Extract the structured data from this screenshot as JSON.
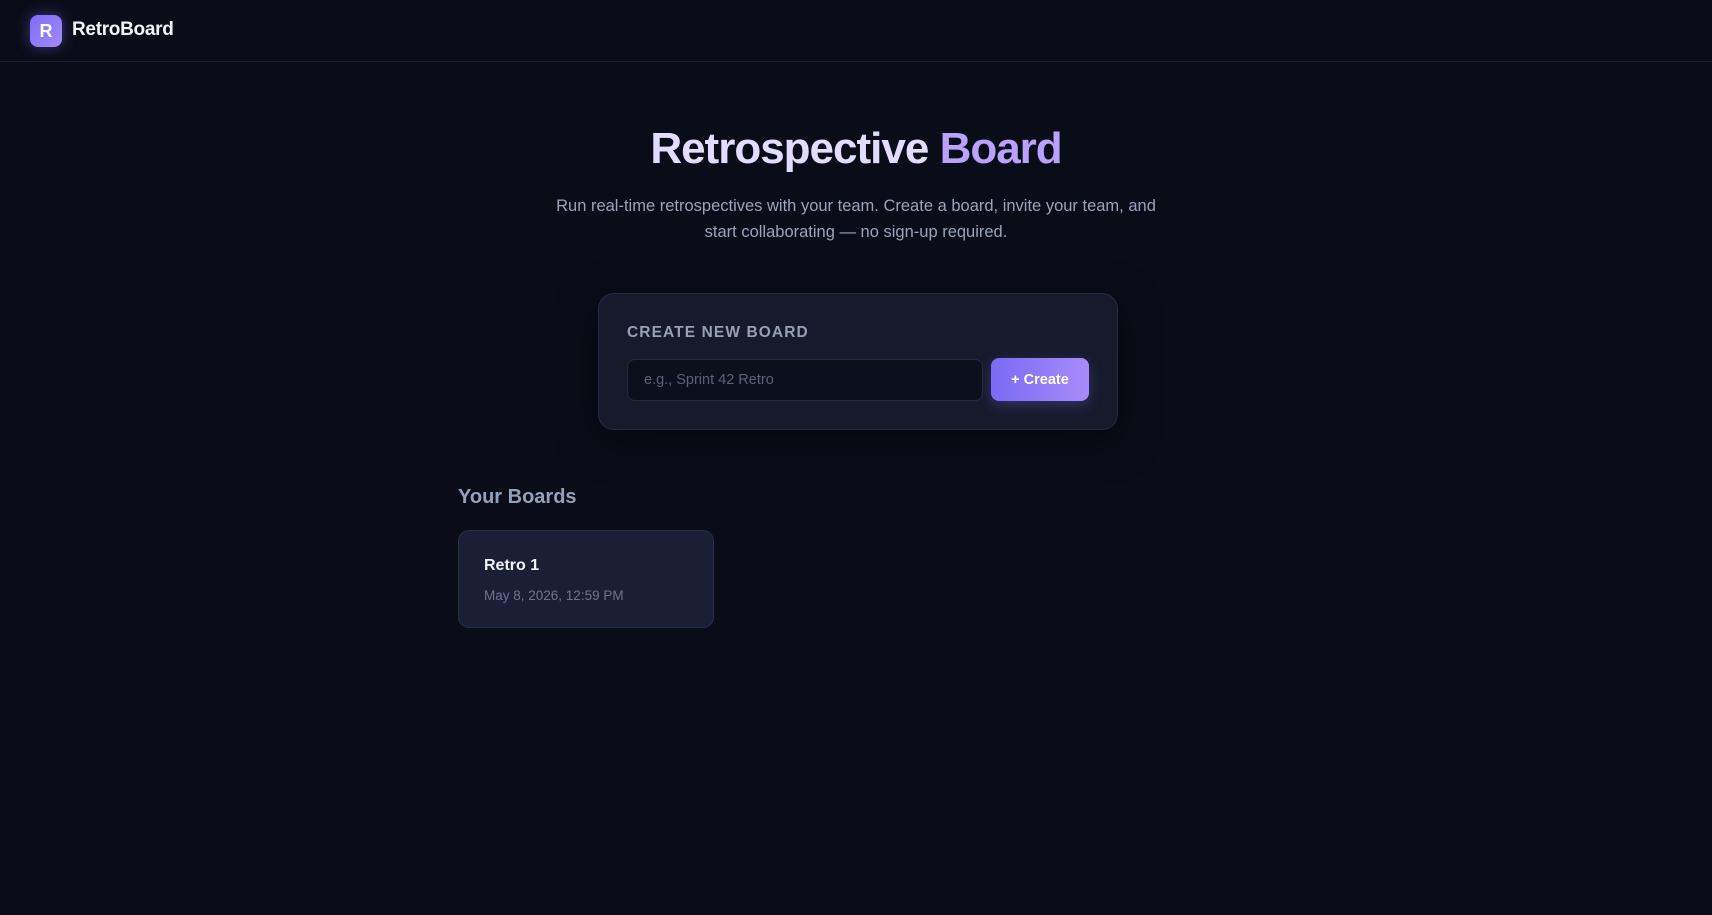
{
  "header": {
    "logo_letter": "R",
    "app_name": "RetroBoard"
  },
  "hero": {
    "title_part1": "Retrospective",
    "title_part2": "Board",
    "subtitle": "Run real-time retrospectives with your team. Create a board, invite your team, and start collaborating — no sign-up required."
  },
  "create_board": {
    "label": "CREATE NEW BOARD",
    "input_value": "",
    "input_placeholder": "e.g., Sprint 42 Retro",
    "button_label": "+ Create"
  },
  "boards": {
    "section_title": "Your Boards",
    "items": [
      {
        "name": "Retro 1",
        "date": "May 8, 2026, 12:59 PM"
      }
    ]
  },
  "colors": {
    "background": "#0a0d18",
    "accent_start": "#7a6af4",
    "accent_end": "#a78bfa",
    "card": "#161a2b"
  }
}
